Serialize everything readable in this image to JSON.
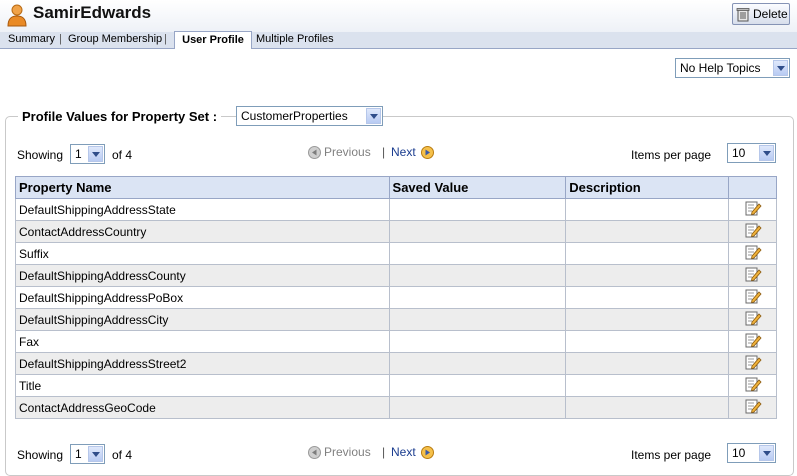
{
  "header": {
    "title": "SamirEdwards",
    "delete_label": "Delete"
  },
  "tabs": [
    {
      "label": "Summary"
    },
    {
      "label": "Group Membership"
    },
    {
      "label": "User Profile",
      "active": true
    },
    {
      "label": "Multiple Profiles"
    }
  ],
  "help_select": {
    "value": "No Help Topics"
  },
  "profile_section": {
    "legend": "Profile Values for Property Set :",
    "property_set": "CustomerProperties"
  },
  "pager_top": {
    "showing_label": "Showing",
    "page": "1",
    "of_label": "of 4",
    "previous_label": "Previous",
    "separator": "|",
    "next_label": "Next",
    "items_per_page_label": "Items per page",
    "items_per_page": "10"
  },
  "pager_bottom": {
    "showing_label": "Showing",
    "page": "1",
    "of_label": "of 4",
    "previous_label": "Previous",
    "separator": "|",
    "next_label": "Next",
    "items_per_page_label": "Items per page",
    "items_per_page": "10"
  },
  "table": {
    "columns": [
      "Property Name",
      "Saved Value",
      "Description",
      ""
    ],
    "rows": [
      {
        "name": "DefaultShippingAddressState",
        "saved": "",
        "description": ""
      },
      {
        "name": "ContactAddressCountry",
        "saved": "",
        "description": ""
      },
      {
        "name": "Suffix",
        "saved": "",
        "description": ""
      },
      {
        "name": "DefaultShippingAddressCounty",
        "saved": "",
        "description": ""
      },
      {
        "name": "DefaultShippingAddressPoBox",
        "saved": "",
        "description": ""
      },
      {
        "name": "DefaultShippingAddressCity",
        "saved": "",
        "description": ""
      },
      {
        "name": "Fax",
        "saved": "",
        "description": ""
      },
      {
        "name": "DefaultShippingAddressStreet2",
        "saved": "",
        "description": ""
      },
      {
        "name": "Title",
        "saved": "",
        "description": ""
      },
      {
        "name": "ContactAddressGeoCode",
        "saved": "",
        "description": ""
      }
    ]
  },
  "colors": {
    "link": "#1a3c8f",
    "tab_bar": "#dbe2ee",
    "table_header": "#dbe4f4",
    "alt_row": "#ededed"
  },
  "icons": {
    "user": "user-icon",
    "delete": "trash-icon",
    "edit": "edit-icon",
    "prev": "arrow-left-circle-icon",
    "next": "arrow-right-circle-icon"
  }
}
